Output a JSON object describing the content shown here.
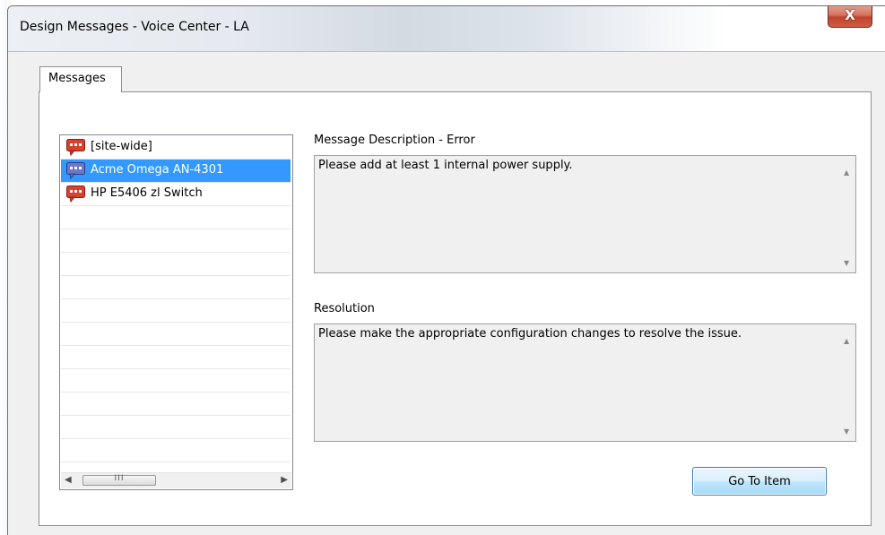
{
  "window": {
    "title": "Design Messages - Voice Center - LA",
    "close_symbol": "X"
  },
  "tabs": [
    {
      "label": "Messages",
      "active": true
    }
  ],
  "messages_list": {
    "items": [
      {
        "label": "[site-wide]",
        "icon": "error-message-icon",
        "selected": false
      },
      {
        "label": "Acme Omega AN-4301",
        "icon": "info-message-icon",
        "selected": true
      },
      {
        "label": "HP E5406 zl Switch",
        "icon": "error-message-icon",
        "selected": false
      }
    ],
    "scroll_grip": "III"
  },
  "description": {
    "label": "Message Description - Error",
    "text": "Please add at least 1 internal power supply."
  },
  "resolution": {
    "label": "Resolution",
    "text": "Please make the appropriate configuration changes to resolve the issue."
  },
  "buttons": {
    "go_to_item": "Go To Item"
  },
  "colors": {
    "selection": "#3399ff",
    "error_icon": "#d9412d",
    "info_icon": "#6b78c8",
    "close_button": "#c0432d"
  }
}
